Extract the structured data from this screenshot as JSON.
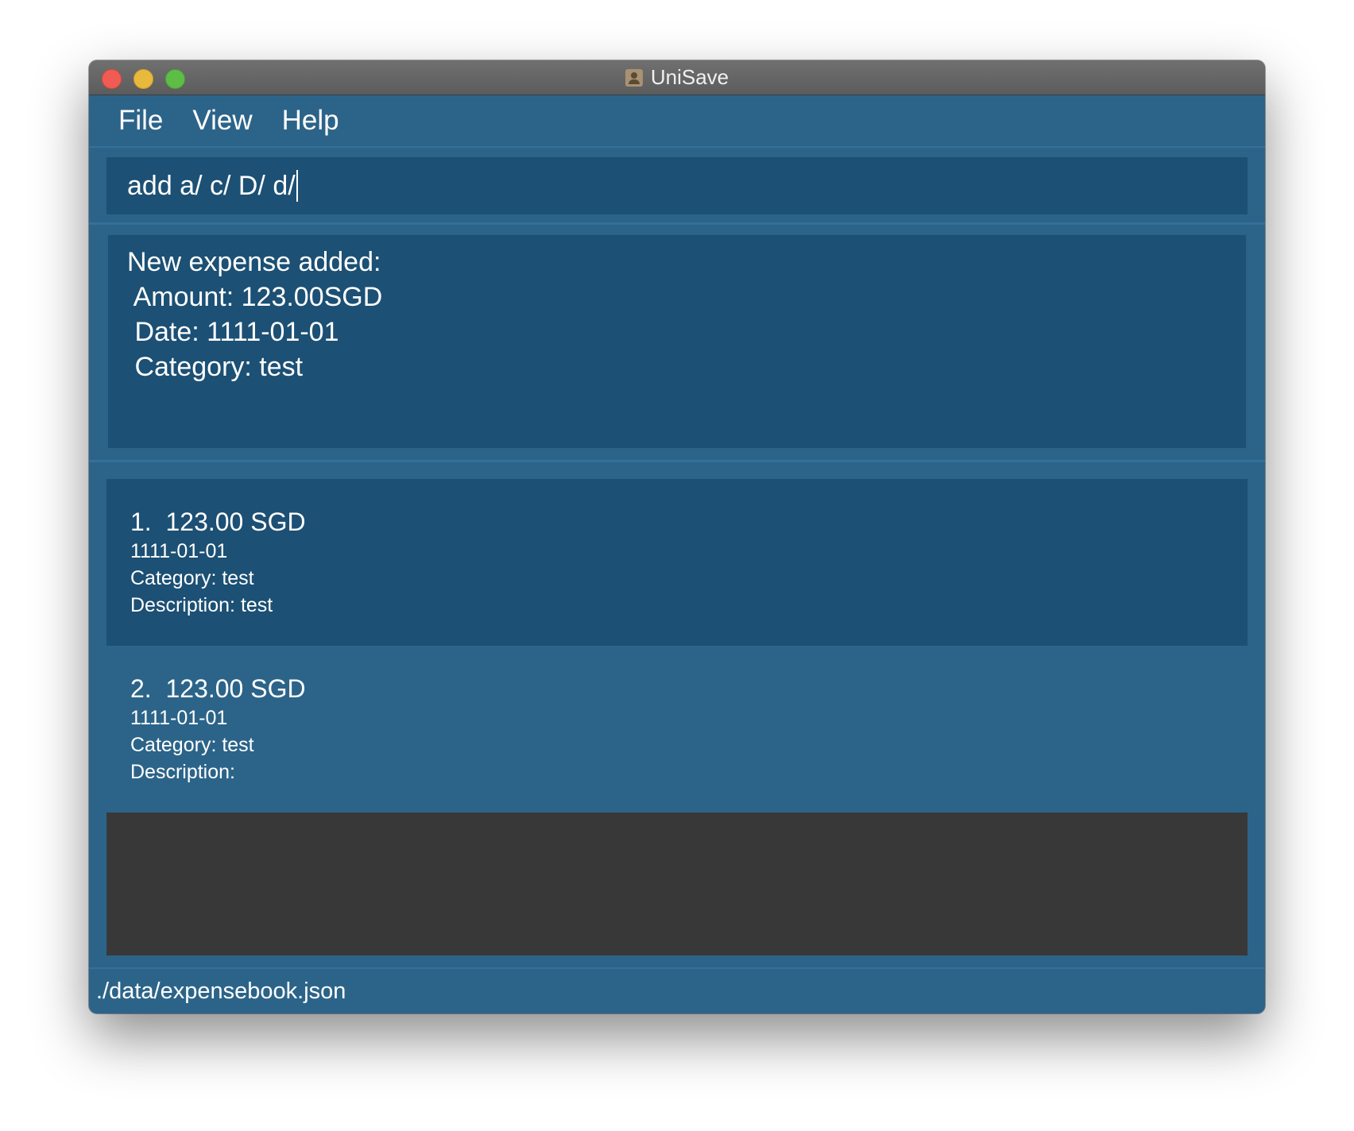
{
  "window": {
    "title": "UniSave"
  },
  "menu": {
    "items": [
      {
        "label": "File"
      },
      {
        "label": "View"
      },
      {
        "label": "Help"
      }
    ]
  },
  "command": {
    "value": "add a/ c/ D/ d/"
  },
  "result": {
    "lines": [
      "New expense added:",
      " Amount: 123.00SGD",
      " Date: 1111-01-01",
      " Category: test"
    ]
  },
  "expenses": [
    {
      "index": "1.",
      "amount": "123.00 SGD",
      "date": "1111-01-01",
      "category": "Category: test",
      "description": "Description: test"
    },
    {
      "index": "2.",
      "amount": "123.00 SGD",
      "date": "1111-01-01",
      "category": "Category: test",
      "description": "Description:"
    }
  ],
  "status": {
    "path": "./data/expensebook.json"
  },
  "icons": {
    "close": "close-button-icon",
    "minimize": "minimize-button-icon",
    "zoom": "zoom-button-icon",
    "app": "app-icon"
  },
  "colors": {
    "background": "#2c6489",
    "panel": "#1c5074",
    "empty_panel": "#383838",
    "text": "#ffffff",
    "close": "#f05c53",
    "minimize": "#e8b93c",
    "zoom": "#5ebd47"
  }
}
